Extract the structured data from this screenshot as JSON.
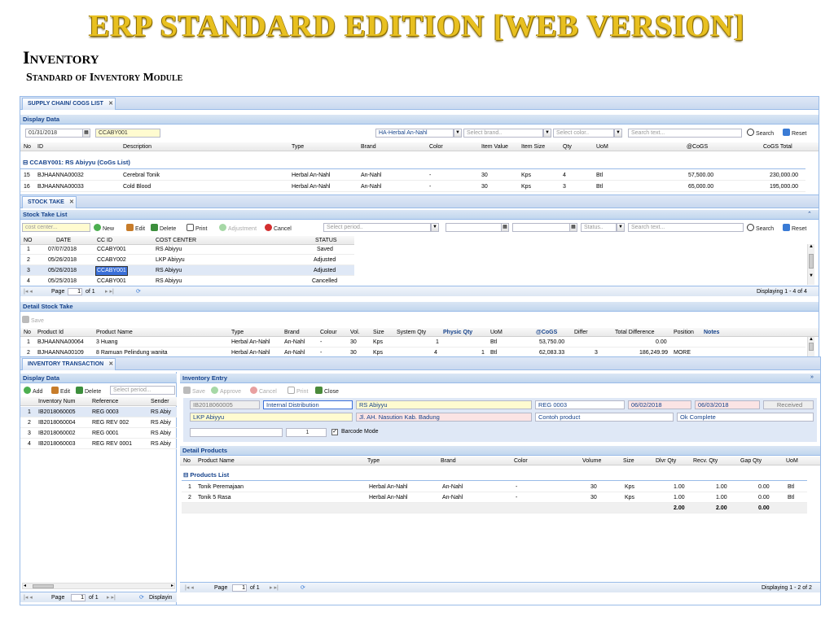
{
  "header": {
    "title": "ERP STANDARD EDITION [WEB VERSION]",
    "section": "Inventory",
    "subsection": "Standard of Inventory Module"
  },
  "cogs": {
    "tab": "SUPPLY CHAIN/ COGS LIST",
    "display_title": "Display Data",
    "date": "01/31/2018",
    "cost_center": "CCABY001",
    "brand_filter": "HA-Herbal An-Nahl",
    "brand_placeholder": "Select brand..",
    "color_placeholder": "Select color..",
    "search_placeholder": "Search text...",
    "search_label": "Search",
    "reset_label": "Reset",
    "columns": [
      "No",
      "ID",
      "Description",
      "Type",
      "Brand",
      "Color",
      "Item Value",
      "Item Size",
      "Qty",
      "UoM",
      "@CoGS",
      "CoGS Total"
    ],
    "group": "CCABY001: RS Abiyyu (CoGs List)",
    "rows": [
      [
        "15",
        "BJHAANNA00032",
        "Cerebral Tonik",
        "Herbal An-Nahl",
        "An-Nahl",
        "-",
        "30",
        "Kps",
        "4",
        "Btl",
        "57,500.00",
        "230,000.00"
      ],
      [
        "16",
        "BJHAANNA00033",
        "Cold Blood",
        "Herbal An-Nahl",
        "An-Nahl",
        "-",
        "30",
        "Kps",
        "3",
        "Btl",
        "65,000.00",
        "195,000.00"
      ]
    ]
  },
  "stock": {
    "tab": "STOCK TAKE",
    "list_title": "Stock Take List",
    "cost_center_placeholder": "cost center...",
    "new_label": "New",
    "edit_label": "Edit",
    "delete_label": "Delete",
    "print_label": "Print",
    "adjustment_label": "Adjustment",
    "cancel_label": "Cancel",
    "period_placeholder": "Select period..",
    "status_placeholder": "Status..",
    "search_placeholder": "Search text...",
    "search_label": "Search",
    "reset_label": "Reset",
    "columns": [
      "NO",
      "DATE",
      "CC ID",
      "COST CENTER",
      "STATUS"
    ],
    "rows": [
      [
        "1",
        "07/07/2018",
        "CCABY001",
        "RS Abiyyu",
        "Saved"
      ],
      [
        "2",
        "05/26/2018",
        "CCABY002",
        "LKP Abiyyu",
        "Adjusted"
      ],
      [
        "3",
        "05/26/2018",
        "CCABY001",
        "RS Abiyyu",
        "Adjusted"
      ],
      [
        "4",
        "05/25/2018",
        "CCABY001",
        "RS Abiyyu",
        "Cancelled"
      ]
    ],
    "page_label": "Page",
    "page_value": "1",
    "page_of": "of 1",
    "displaying": "Displaying 1 - 4 of 4",
    "detail_title": "Detail Stock Take",
    "save_label": "Save",
    "detail_columns": [
      "No",
      "Product Id",
      "Product Name",
      "Type",
      "Brand",
      "Colour",
      "Vol.",
      "Size",
      "System Qty",
      "Physic Qty",
      "UoM",
      "@CoGS",
      "Differ",
      "Total Difference",
      "Position",
      "Notes"
    ],
    "detail_rows": [
      [
        "1",
        "BJHAANNA00064",
        "3 Huang",
        "Herbal An-Nahl",
        "An-Nahl",
        "-",
        "30",
        "Kps",
        "1",
        "",
        "Btl",
        "53,750.00",
        "",
        "0.00",
        "",
        ""
      ],
      [
        "2",
        "BJHAANNA00109",
        "8 Ramuan Pelindung wanita",
        "Herbal An-Nahl",
        "An-Nahl",
        "-",
        "30",
        "Kps",
        "4",
        "1",
        "Btl",
        "62,083.33",
        "3",
        "186,249.99",
        "MORE",
        ""
      ]
    ]
  },
  "trans": {
    "tab": "INVENTORY TRANSACTION",
    "display_title": "Display Data",
    "add_label": "Add",
    "edit_label": "Edit",
    "delete_label": "Delete",
    "period_placeholder": "Select period...",
    "columns": [
      "Inventory Num",
      "Reference",
      "Sender"
    ],
    "rows": [
      [
        "1",
        "IB2018060005",
        "REG 0003",
        "RS Abiy"
      ],
      [
        "2",
        "IB2018060004",
        "REG REV 002",
        "RS Abiy"
      ],
      [
        "3",
        "IB2018060002",
        "REG 0001",
        "RS Abiy"
      ],
      [
        "4",
        "IB2018060003",
        "REG REV 0001",
        "RS Abiy"
      ]
    ],
    "page_label": "Page",
    "page_value": "1",
    "page_of": "of 1",
    "displaying": "Displayin",
    "entry_title": "Inventory Entry",
    "save_label": "Save",
    "approve_label": "Approve",
    "cancel_label": "Cancel",
    "print_label": "Print",
    "close_label": "Close",
    "entry": {
      "number": "IB2018060005",
      "type": "Internal Distribution",
      "sender": "RS Abiyyu",
      "reference": "REG 0003",
      "date1": "06/02/2018",
      "date2": "06/03/2018",
      "status": "Received",
      "receiver": "LKP Abiyyu",
      "address": "Jl. AH. Nasution Kab. Badung",
      "note": "Contoh product",
      "remark": "Ok Complete",
      "qty": "1",
      "barcode": "Barcode Mode"
    },
    "detail_title": "Detail Products",
    "detail_columns": [
      "No",
      "Product Name",
      "Type",
      "Brand",
      "Color",
      "Volume",
      "Size",
      "Dlvr Qty",
      "Recv. Qty",
      "Gap Qty",
      "UoM"
    ],
    "group": "Products List",
    "detail_rows": [
      [
        "1",
        "Tonik Peremajaan",
        "Herbal An-Nahl",
        "An-Nahl",
        "-",
        "30",
        "Kps",
        "1.00",
        "1.00",
        "0.00",
        "Btl"
      ],
      [
        "2",
        "Tonik 5 Rasa",
        "Herbal An-Nahl",
        "An-Nahl",
        "-",
        "30",
        "Kps",
        "1.00",
        "1.00",
        "0.00",
        "Btl"
      ]
    ],
    "totals": [
      "2.00",
      "2.00",
      "0.00"
    ],
    "d_page_label": "Page",
    "d_page_value": "1",
    "d_page_of": "of 1",
    "d_displaying": "Displaying 1 - 2 of 2"
  }
}
